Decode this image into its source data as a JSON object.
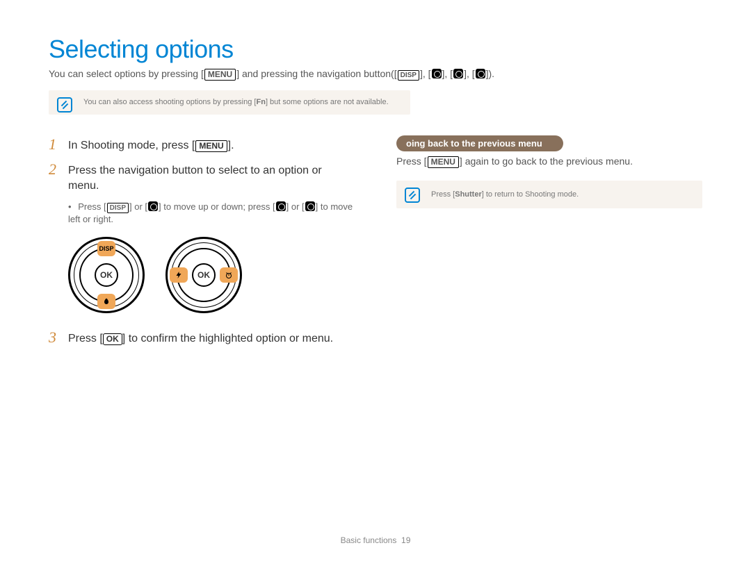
{
  "title": "Selecting options",
  "intro_a": "You can select options by pressing [",
  "intro_menu": "MENU",
  "intro_b": "] and pressing the navigation button([",
  "intro_disp": "DISP",
  "intro_c": "], [",
  "intro_d": "], [",
  "intro_e": "], [",
  "intro_f": "]).",
  "note1_a": "You can also access shooting options by pressing [",
  "note1_fn": "Fn",
  "note1_b": "] but some options are not available.",
  "steps": {
    "s1_num": "1",
    "s1_a": "In Shooting mode, press [",
    "s1_menu": "MENU",
    "s1_b": "].",
    "s2_num": "2",
    "s2_text": "Press the navigation button to select to an option or menu.",
    "s2_sub_a": "Press [",
    "s2_sub_disp": "DISP",
    "s2_sub_b": "] or [",
    "s2_sub_c": "] to move up or down; press [",
    "s2_sub_d": "] or [",
    "s2_sub_e": "] to move left or right.",
    "s3_num": "3",
    "s3_a": "Press [",
    "s3_ok": "OK",
    "s3_b": "] to conﬁrm the highlighted option or menu."
  },
  "dial_ok": "OK",
  "dial_disp": "DISP",
  "right": {
    "pill": "oing back to the previous menu",
    "line_a": "Press [",
    "line_menu": "MENU",
    "line_b": "] again to go back to the previous menu.",
    "note_a": "Press [",
    "note_shutter": "Shutter",
    "note_b": "] to return to Shooting mode."
  },
  "footer_label": "Basic functions",
  "footer_page": "19"
}
